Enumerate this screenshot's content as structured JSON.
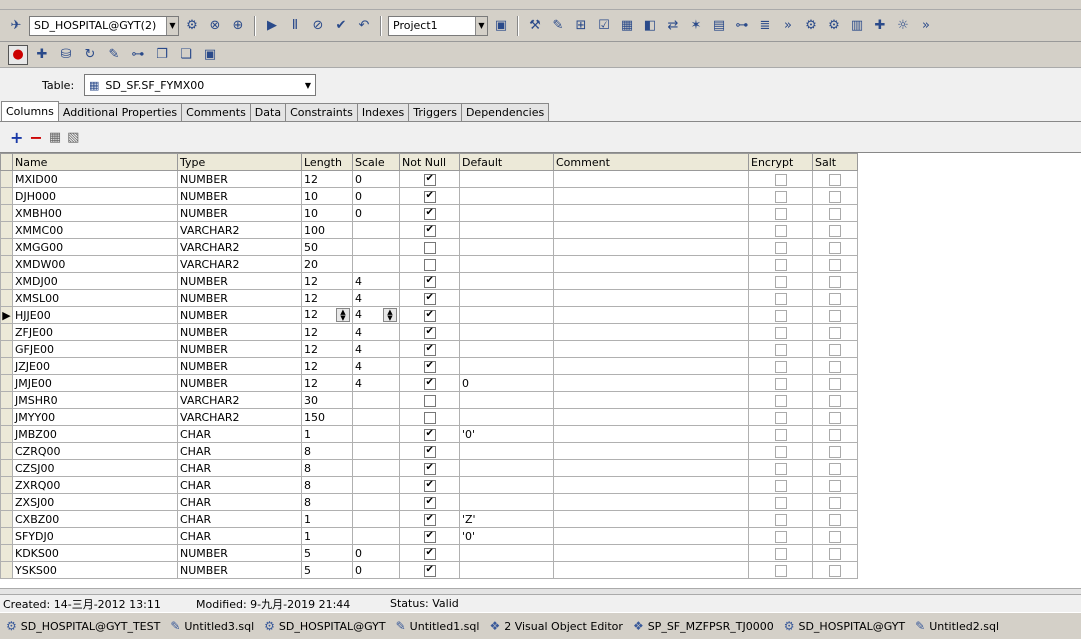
{
  "toolbar1": {
    "connection": "SD_HOSPITAL@GYT(2)",
    "project": "Project1"
  },
  "table_selector": {
    "label": "Table:",
    "value": "SD_SF.SF_FYMX00"
  },
  "tabs": [
    {
      "label": "Columns"
    },
    {
      "label": "Additional Properties"
    },
    {
      "label": "Comments"
    },
    {
      "label": "Data"
    },
    {
      "label": "Constraints"
    },
    {
      "label": "Indexes"
    },
    {
      "label": "Triggers"
    },
    {
      "label": "Dependencies"
    }
  ],
  "grid": {
    "headers": [
      "Name",
      "Type",
      "Length",
      "Scale",
      "Not Null",
      "Default",
      "Comment",
      "Encrypt",
      "Salt"
    ],
    "rows": [
      {
        "name": "MXID00",
        "type": "NUMBER",
        "length": "12",
        "scale": "0",
        "notnull": true,
        "default": ""
      },
      {
        "name": "DJH000",
        "type": "NUMBER",
        "length": "10",
        "scale": "0",
        "notnull": true,
        "default": ""
      },
      {
        "name": "XMBH00",
        "type": "NUMBER",
        "length": "10",
        "scale": "0",
        "notnull": true,
        "default": ""
      },
      {
        "name": "XMMC00",
        "type": "VARCHAR2",
        "length": "100",
        "scale": "",
        "notnull": true,
        "default": ""
      },
      {
        "name": "XMGG00",
        "type": "VARCHAR2",
        "length": "50",
        "scale": "",
        "notnull": false,
        "default": ""
      },
      {
        "name": "XMDW00",
        "type": "VARCHAR2",
        "length": "20",
        "scale": "",
        "notnull": false,
        "default": ""
      },
      {
        "name": "XMDJ00",
        "type": "NUMBER",
        "length": "12",
        "scale": "4",
        "notnull": true,
        "default": ""
      },
      {
        "name": "XMSL00",
        "type": "NUMBER",
        "length": "12",
        "scale": "4",
        "notnull": true,
        "default": ""
      },
      {
        "name": "HJJE00",
        "type": "NUMBER",
        "length": "12",
        "scale": "4",
        "notnull": true,
        "default": "",
        "current": true
      },
      {
        "name": "ZFJE00",
        "type": "NUMBER",
        "length": "12",
        "scale": "4",
        "notnull": true,
        "default": ""
      },
      {
        "name": "GFJE00",
        "type": "NUMBER",
        "length": "12",
        "scale": "4",
        "notnull": true,
        "default": ""
      },
      {
        "name": "JZJE00",
        "type": "NUMBER",
        "length": "12",
        "scale": "4",
        "notnull": true,
        "default": ""
      },
      {
        "name": "JMJE00",
        "type": "NUMBER",
        "length": "12",
        "scale": "4",
        "notnull": true,
        "default": "0"
      },
      {
        "name": "JMSHR0",
        "type": "VARCHAR2",
        "length": "30",
        "scale": "",
        "notnull": false,
        "default": ""
      },
      {
        "name": "JMYY00",
        "type": "VARCHAR2",
        "length": "150",
        "scale": "",
        "notnull": false,
        "default": ""
      },
      {
        "name": "JMBZ00",
        "type": "CHAR",
        "length": "1",
        "scale": "",
        "notnull": true,
        "default": "'0'"
      },
      {
        "name": "CZRQ00",
        "type": "CHAR",
        "length": "8",
        "scale": "",
        "notnull": true,
        "default": ""
      },
      {
        "name": "CZSJ00",
        "type": "CHAR",
        "length": "8",
        "scale": "",
        "notnull": true,
        "default": ""
      },
      {
        "name": "ZXRQ00",
        "type": "CHAR",
        "length": "8",
        "scale": "",
        "notnull": true,
        "default": ""
      },
      {
        "name": "ZXSJ00",
        "type": "CHAR",
        "length": "8",
        "scale": "",
        "notnull": true,
        "default": ""
      },
      {
        "name": "CXBZ00",
        "type": "CHAR",
        "length": "1",
        "scale": "",
        "notnull": true,
        "default": "'Z'"
      },
      {
        "name": "SFYDJ0",
        "type": "CHAR",
        "length": "1",
        "scale": "",
        "notnull": true,
        "default": "'0'"
      },
      {
        "name": "KDKS00",
        "type": "NUMBER",
        "length": "5",
        "scale": "0",
        "notnull": true,
        "default": ""
      },
      {
        "name": "YSKS00",
        "type": "NUMBER",
        "length": "5",
        "scale": "0",
        "notnull": true,
        "default": ""
      }
    ]
  },
  "status": {
    "created": "Created: 14-三月-2012 13:11",
    "modified": "Modified: 9-九月-2019 21:44",
    "state": "Status: Valid"
  },
  "taskbar": [
    {
      "label": "SD_HOSPITAL@GYT_TEST",
      "icon": "connection-icon"
    },
    {
      "label": "Untitled3.sql",
      "icon": "sql-window-icon"
    },
    {
      "label": "SD_HOSPITAL@GYT",
      "icon": "connection-icon"
    },
    {
      "label": "Untitled1.sql",
      "icon": "sql-window-icon"
    },
    {
      "label": "2 Visual Object Editor",
      "icon": "object-editor-icon"
    },
    {
      "label": "SP_SF_MZFPSR_TJ0000",
      "icon": "object-editor-icon"
    },
    {
      "label": "SD_HOSPITAL@GYT",
      "icon": "connection-icon"
    },
    {
      "label": "Untitled2.sql",
      "icon": "sql-window-icon"
    }
  ]
}
